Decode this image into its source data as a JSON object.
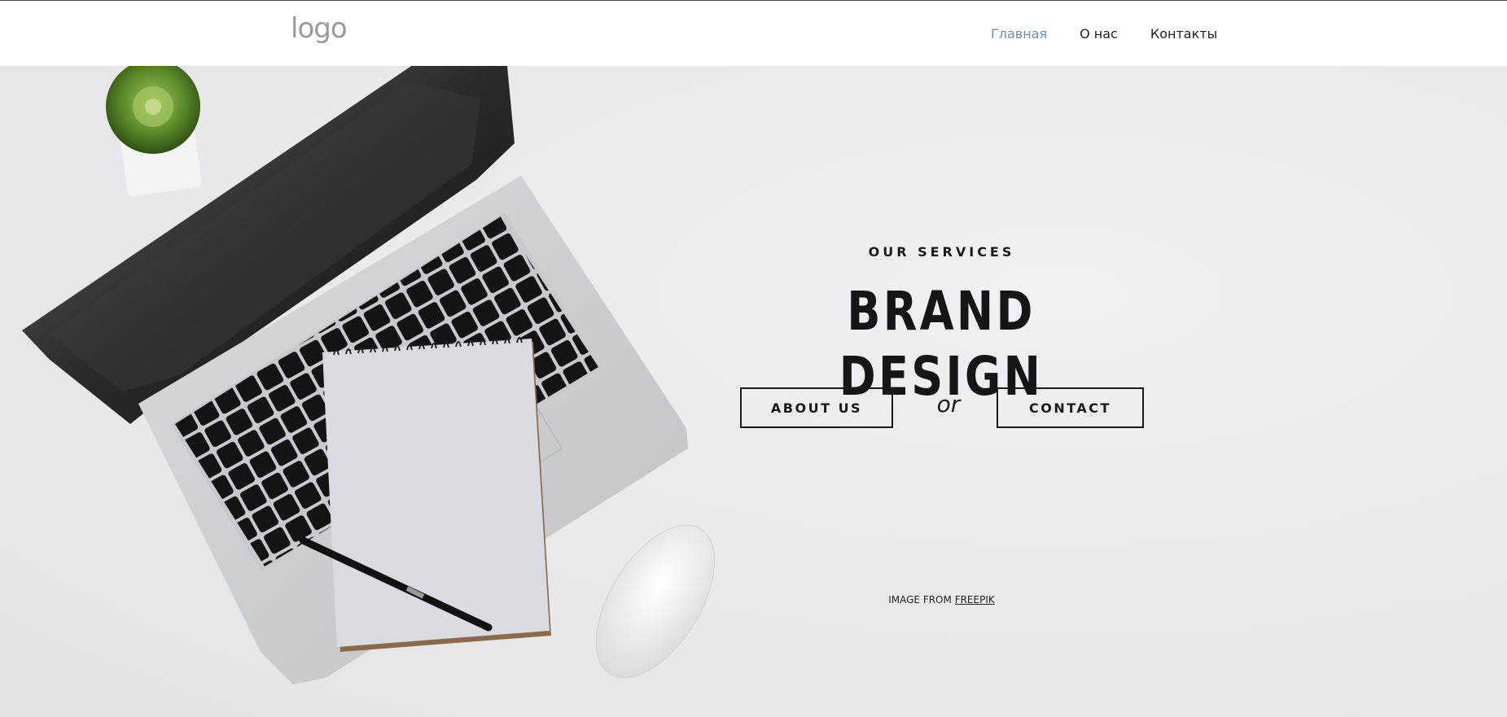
{
  "header": {
    "logo_text": "logo",
    "nav": [
      {
        "label": "Главная",
        "active": true
      },
      {
        "label": "О нас",
        "active": false
      },
      {
        "label": "Контакты",
        "active": false
      }
    ]
  },
  "hero": {
    "eyebrow": "OUR SERVICES",
    "title": "BRAND DESIGN",
    "about_button": "ABOUT US",
    "or_text": "or",
    "contact_button": "CONTACT",
    "credit_prefix": "IMAGE FROM",
    "credit_link": "FREEPIK"
  },
  "colors": {
    "nav_active": "#6f8fb2",
    "text": "#1a1a1a",
    "hero_background": "#ececee"
  },
  "icons": [
    "logo-icon"
  ]
}
